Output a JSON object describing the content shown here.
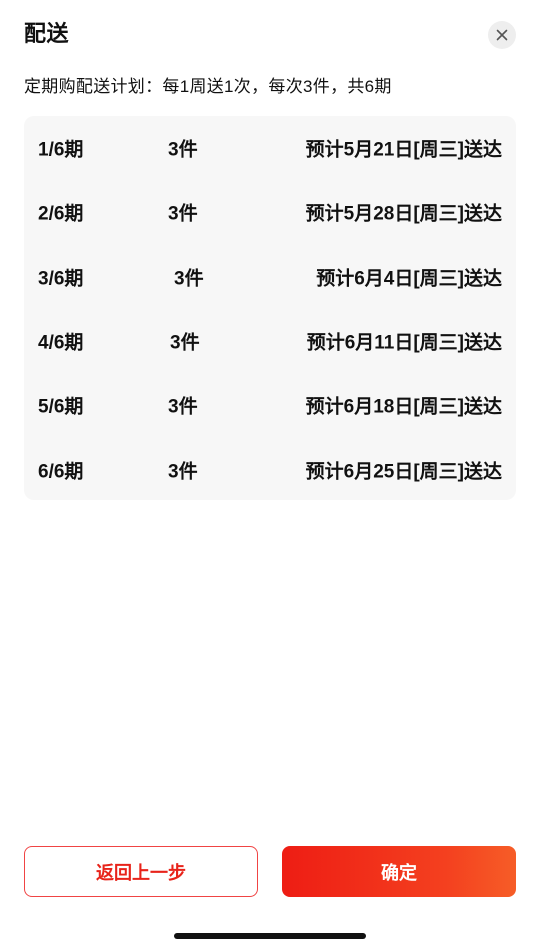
{
  "dialog": {
    "title": "配送",
    "close_icon": "close-icon"
  },
  "plan": {
    "summary": "定期购配送计划：每1周送1次，每次3件，共6期"
  },
  "schedule": [
    {
      "period": "1/6期",
      "quantity": "3件",
      "eta": "预计5月21日[周三]送达"
    },
    {
      "period": "2/6期",
      "quantity": "3件",
      "eta": "预计5月28日[周三]送达"
    },
    {
      "period": "3/6期",
      "quantity": "3件",
      "eta": "预计6月4日[周三]送达"
    },
    {
      "period": "4/6期",
      "quantity": "3件",
      "eta": "预计6月11日[周三]送达"
    },
    {
      "period": "5/6期",
      "quantity": "3件",
      "eta": "预计6月18日[周三]送达"
    },
    {
      "period": "6/6期",
      "quantity": "3件",
      "eta": "预计6月25日[周三]送达"
    }
  ],
  "footer": {
    "back_label": "返回上一步",
    "confirm_label": "确定"
  },
  "colors": {
    "accent": "#ee1d14",
    "panel_bg": "#f7f7f7",
    "close_bg": "#eeeeee"
  }
}
